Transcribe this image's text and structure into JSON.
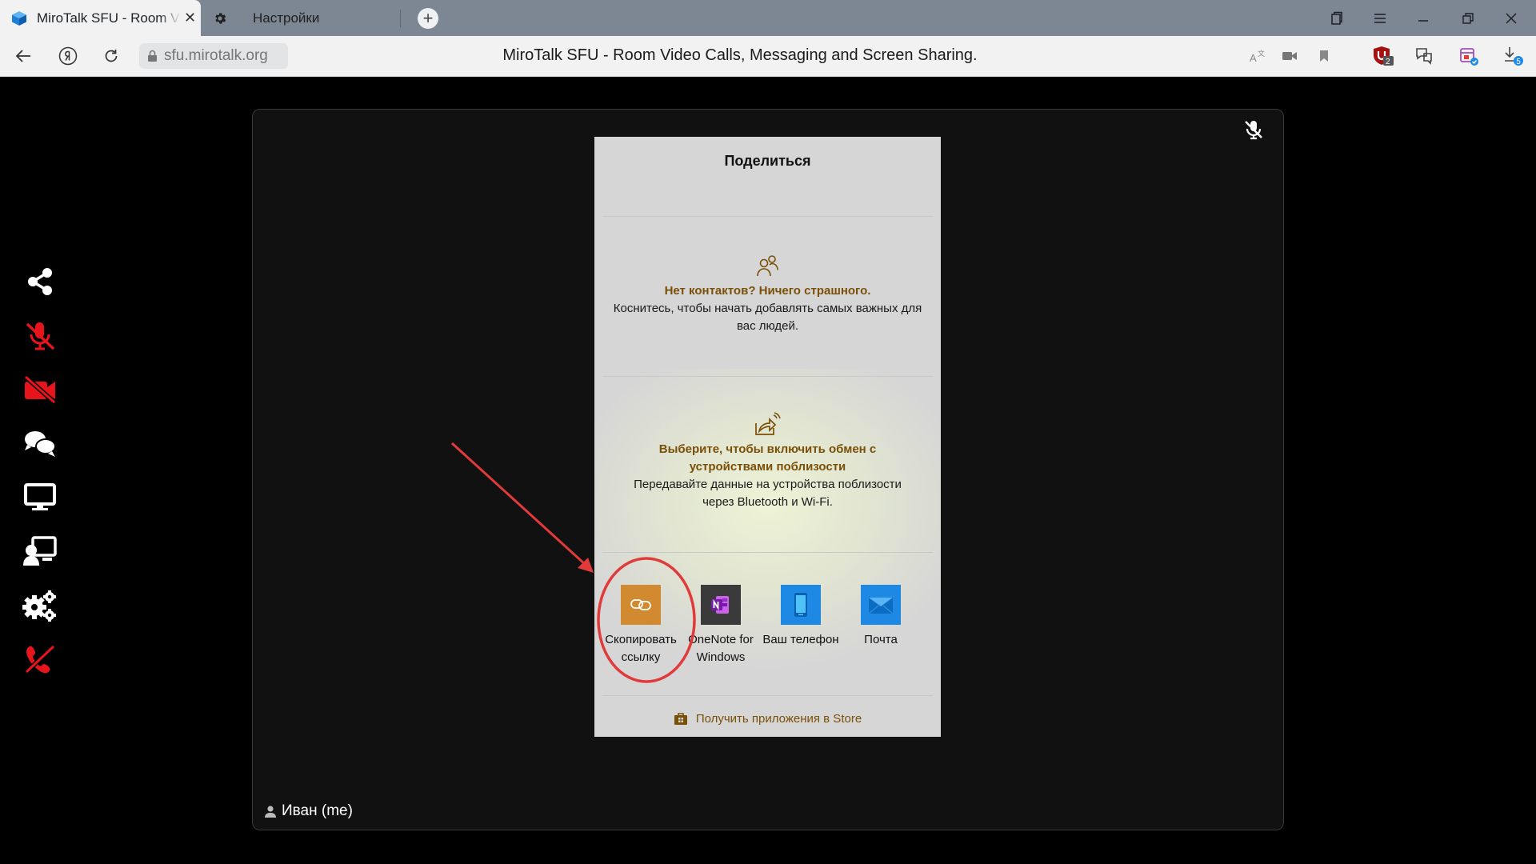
{
  "browser": {
    "active_tab_title": "MiroTalk SFU - Room Video Calls, Messaging and Screen Sharing.",
    "close_glyph": "✕",
    "settings_tab_title": "Настройки",
    "new_tab_glyph": "+",
    "url": "sfu.mirotalk.org",
    "page_title": "MiroTalk SFU - Room Video Calls, Messaging and Screen Sharing.",
    "badges": {
      "ublock": "2",
      "downloads": "5"
    }
  },
  "sidebar": {
    "items": [
      "share-icon",
      "mic-off-icon",
      "camera-off-icon",
      "chat-icon",
      "screen-share-icon",
      "presenter-icon",
      "settings-icon",
      "hang-up-icon"
    ],
    "accent_red": "#e8141b",
    "icon_white": "#ffffff"
  },
  "video": {
    "participant_name": "Иван (me)"
  },
  "share_dialog": {
    "title": "Поделиться",
    "contacts_heading": "Нет контактов? Ничего страшного.",
    "contacts_body": "Коснитесь, чтобы начать добавлять самых важных для вас людей.",
    "nearby_heading": "Выберите, чтобы включить обмен с устройствами поблизости",
    "nearby_body": "Передавайте данные на устройства поблизости через Bluetooth и Wi-Fi.",
    "apps": [
      {
        "label": "Скопировать ссылку",
        "icon": "link-icon",
        "color": "#d18a2f"
      },
      {
        "label": "OneNote for Windows",
        "icon": "onenote-icon",
        "color": "#3a3a3a"
      },
      {
        "label": "Ваш телефон",
        "icon": "phone-icon",
        "color": "#1e88e5"
      },
      {
        "label": "Почта",
        "icon": "mail-icon",
        "color": "#1e88e5"
      }
    ],
    "store_link": "Получить приложения в Store"
  }
}
